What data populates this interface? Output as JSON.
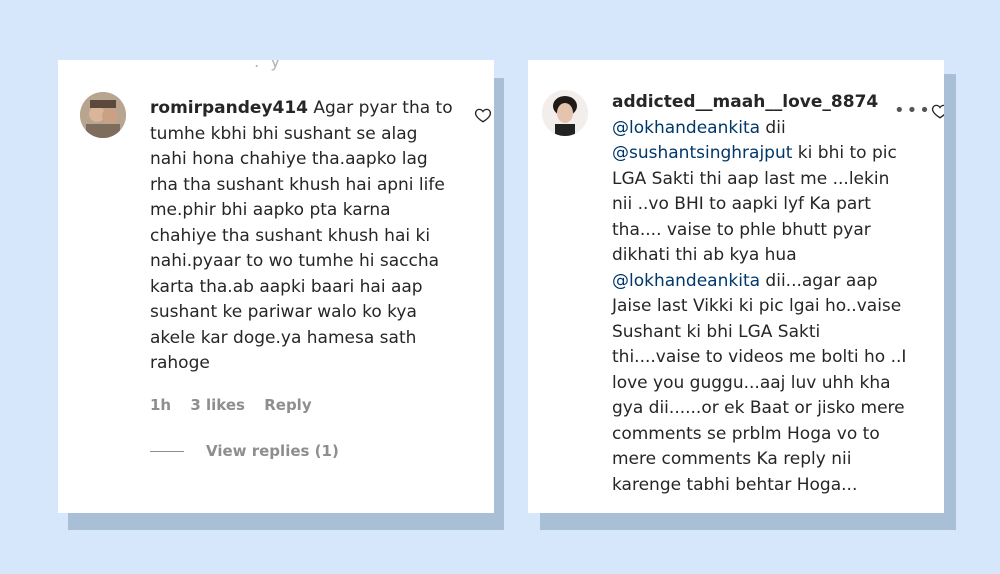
{
  "comment1": {
    "username": "romirpandey414",
    "text_lines": [
      "Agar pyar tha to",
      "tumhe kbhi bhi sushant se alag",
      "nahi hona chahiye tha.aapko lag",
      "rha tha sushant khush hai apni life",
      "me.phir bhi aapko pta karna",
      "chahiye tha sushant khush hai ki",
      "nahi.pyaar to wo tumhe hi saccha",
      "karta tha.ab aapki baari hai aap",
      "sushant ke pariwar walo ko kya",
      "akele kar doge.ya hamesa sath",
      "rahoge"
    ],
    "time": "1h",
    "likes": "3 likes",
    "reply": "Reply",
    "view_replies": "View replies (1)"
  },
  "comment2": {
    "username": "addicted__maah__love_8874",
    "mention1": "@lokhandeankita",
    "line1_rest": " dii",
    "mention2": "@sushantsinghrajput",
    "line2_rest": " ki bhi to pic",
    "body_lines_a": [
      "LGA Sakti thi aap last me ...lekin",
      "nii ..vo BHI to aapki lyf Ka part",
      "tha.... vaise to phle bhutt pyar",
      "dikhati thi ab kya hua"
    ],
    "mention3": "@lokhandeankita",
    "line3_rest": " dii...agar aap",
    "body_lines_b": [
      "Jaise last Vikki ki pic lgai ho..vaise",
      "Sushant ki bhi LGA Sakti",
      "thi....vaise to videos me bolti ho ..I",
      "love you guggu...aaj luv uhh kha",
      "gya dii......or ek Baat or jisko mere",
      "comments se prblm Hoga vo to",
      "mere comments Ka reply nii",
      "karenge tabhi behtar Hoga..."
    ]
  },
  "icons": [
    "heart-icon",
    "more-options-icon",
    "avatar"
  ],
  "colors": {
    "background": "#d6e7fb",
    "mention": "#00376b",
    "meta": "#8e8e8e"
  }
}
